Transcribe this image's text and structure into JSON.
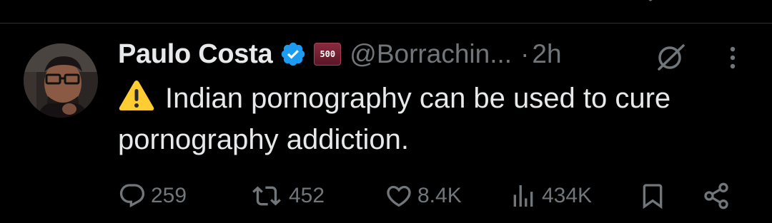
{
  "tweet": {
    "author": {
      "display_name": "Paulo Costa",
      "handle": "@Borrachin...",
      "verified": true,
      "affiliate_badge_text": "500",
      "avatar_icon": "avatar"
    },
    "separator": "·",
    "time": "2h",
    "text_line": "Indian pornography can be used to cure pornography addiction.",
    "warning_icon": "warning-icon",
    "actions": {
      "replies": "259",
      "reposts": "452",
      "likes": "8.4K",
      "views": "434K"
    }
  },
  "colors": {
    "background": "#000000",
    "text": "#e7e9ea",
    "muted": "#71767b",
    "verified_blue": "#1d9bf0",
    "divider": "#2f3336",
    "warning_yellow": "#ffcc33"
  }
}
